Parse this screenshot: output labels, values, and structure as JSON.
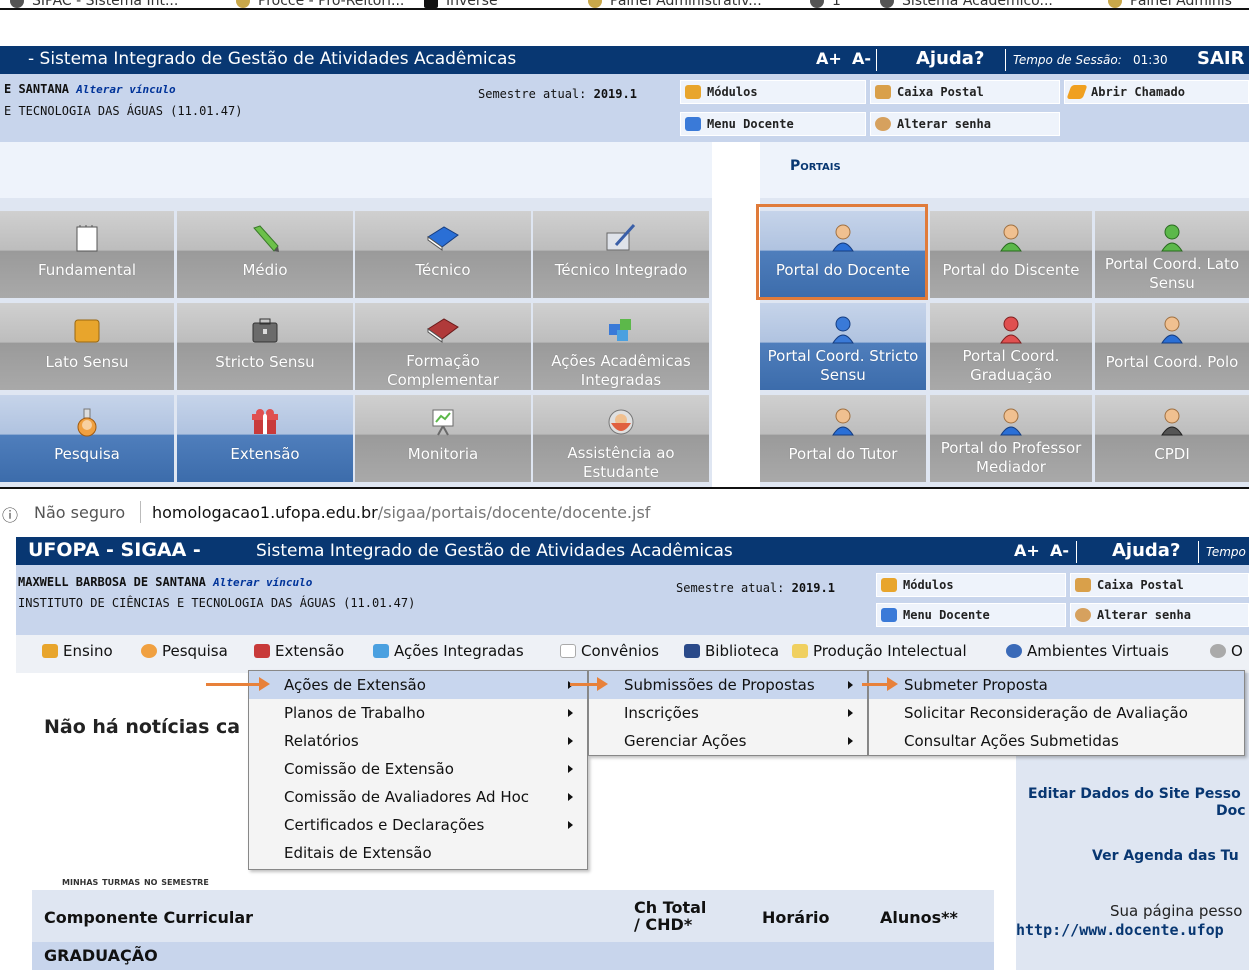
{
  "bookmarks": [
    {
      "label": "SIPAC - Sistema Int...",
      "icon": "circle-globe-icon"
    },
    {
      "label": "Procce - Pró-Reitori...",
      "icon": "folder-icon"
    },
    {
      "label": "Inverse",
      "icon": "inverse-icon"
    },
    {
      "label": "Painel Administrativ...",
      "icon": "folder-icon"
    },
    {
      "label": "1",
      "icon": "circle-globe-icon"
    },
    {
      "label": "Sistema Acadêmico...",
      "icon": "circle-globe-icon"
    },
    {
      "label": "Painel Adminis",
      "icon": "folder-icon"
    }
  ],
  "top": {
    "title": "-  Sistema Integrado de Gestão de Atividades Acadêmicas",
    "font_up": "A+",
    "font_down": "A-",
    "help": "Ajuda?",
    "session_label": "Tempo de Sessão:",
    "session_time": "01:30",
    "exit": "SAIR",
    "user": "E SANTANA",
    "alter_link": "Alterar vínculo",
    "unit": "E TECNOLOGIA DAS ÁGUAS (11.01.47)",
    "semester_label": "Semestre atual:",
    "semester": "2019.1",
    "modules": "Módulos",
    "mailbox": "Caixa Postal",
    "ticket": "Abrir Chamado",
    "teacher_menu": "Menu Docente",
    "change_password": "Alterar senha",
    "portals_heading": "Portais"
  },
  "modules_grid": [
    {
      "label": "Fundamental",
      "icon": "notepad-icon"
    },
    {
      "label": "Médio",
      "icon": "pencil-icon"
    },
    {
      "label": "Técnico",
      "icon": "book-icon"
    },
    {
      "label": "Técnico Integrado",
      "icon": "edit-icon"
    },
    {
      "label": "Lato Sensu",
      "icon": "folder-icon"
    },
    {
      "label": "Stricto Sensu",
      "icon": "briefcase-icon"
    },
    {
      "label": "Formação Complementar",
      "icon": "red-book-icon"
    },
    {
      "label": "Ações Acadêmicas Integradas",
      "icon": "puzzle-icon"
    },
    {
      "label": "Pesquisa",
      "icon": "flask-icon"
    },
    {
      "label": "Extensão",
      "icon": "gift-icon"
    },
    {
      "label": "Monitoria",
      "icon": "presentation-icon"
    },
    {
      "label": "Assistência ao Estudante",
      "icon": "support-icon"
    }
  ],
  "portals_grid": [
    {
      "label": "Portal do Docente",
      "icon": "teacher-icon"
    },
    {
      "label": "Portal do Discente",
      "icon": "student-icon"
    },
    {
      "label": "Portal Coord. Lato Sensu",
      "icon": "green-user-icon"
    },
    {
      "label": "Portal Coord. Stricto Sensu",
      "icon": "blue-user-icon"
    },
    {
      "label": "Portal Coord. Graduação",
      "icon": "red-user-icon"
    },
    {
      "label": "Portal Coord. Polo",
      "icon": "user-icon"
    },
    {
      "label": "Portal do Tutor",
      "icon": "user-icon"
    },
    {
      "label": "Portal do Professor Mediador",
      "icon": "user-icon"
    },
    {
      "label": "CPDI",
      "icon": "suit-user-icon"
    }
  ],
  "browser": {
    "info_icon": "ⓘ",
    "not_secure": "Não seguro",
    "url_host": "homologacao1.ufopa.edu.br",
    "url_path": "/sigaa/portais/docente/docente.jsf"
  },
  "sigaa": {
    "brand": "UFOPA - SIGAA -",
    "title": "Sistema Integrado de Gestão de Atividades Acadêmicas",
    "font_up": "A+",
    "font_down": "A-",
    "help": "Ajuda?",
    "session_label": "Tempo",
    "user": "MAXWELL BARBOSA DE SANTANA",
    "alter_link": "Alterar vínculo",
    "unit": "INSTITUTO DE CIÊNCIAS E TECNOLOGIA DAS ÁGUAS (11.01.47)",
    "semester_label": "Semestre atual:",
    "semester": "2019.1",
    "modules": "Módulos",
    "mailbox": "Caixa Postal",
    "teacher_menu": "Menu Docente",
    "change_password": "Alterar senha"
  },
  "menu": [
    {
      "label": "Ensino",
      "icon": "ensino-icon"
    },
    {
      "label": "Pesquisa",
      "icon": "flask-icon"
    },
    {
      "label": "Extensão",
      "icon": "gift-icon"
    },
    {
      "label": "Ações Integradas",
      "icon": "puzzle-icon"
    },
    {
      "label": "Convênios",
      "icon": "pages-icon"
    },
    {
      "label": "Biblioteca",
      "icon": "library-icon"
    },
    {
      "label": "Produção Intelectual",
      "icon": "notepad-icon"
    },
    {
      "label": "Ambientes Virtuais",
      "icon": "virtual-icon"
    },
    {
      "label": "O",
      "icon": "other-icon"
    }
  ],
  "dropdown1": [
    {
      "label": "Ações de Extensão",
      "submenu": true
    },
    {
      "label": "Planos de Trabalho",
      "submenu": true
    },
    {
      "label": "Relatórios",
      "submenu": true
    },
    {
      "label": "Comissão de Extensão",
      "submenu": true
    },
    {
      "label": "Comissão de Avaliadores Ad Hoc",
      "submenu": true
    },
    {
      "label": "Certificados e Declarações",
      "submenu": true
    },
    {
      "label": "Editais de Extensão",
      "submenu": false
    }
  ],
  "dropdown2": [
    {
      "label": "Submissões de Propostas",
      "submenu": true
    },
    {
      "label": "Inscrições",
      "submenu": true
    },
    {
      "label": "Gerenciar Ações",
      "submenu": true
    }
  ],
  "dropdown3": [
    {
      "label": "Submeter Proposta"
    },
    {
      "label": "Solicitar Reconsideração de Avaliação"
    },
    {
      "label": "Consultar Ações Submetidas"
    }
  ],
  "content": {
    "news": "Não há notícias ca",
    "classes_heading": "Minhas turmas no semestre",
    "col_component": "Componente Curricular",
    "col_ch": "Ch Total / CHD*",
    "col_time": "Horário",
    "col_students": "Alunos**",
    "section": "GRADUAÇÃO",
    "side_edit": "Editar Dados do Site Pesso",
    "side_edit2": "Doc",
    "side_agenda": "Ver Agenda das Tu",
    "side_page": "Sua página pesso",
    "side_url": "http://www.docente.ufop"
  },
  "colors": {
    "header_blue": "#083772",
    "info_blue": "#c8d5ec",
    "arrow_orange": "#e8813a",
    "highlight_orange": "#e07b3a"
  }
}
